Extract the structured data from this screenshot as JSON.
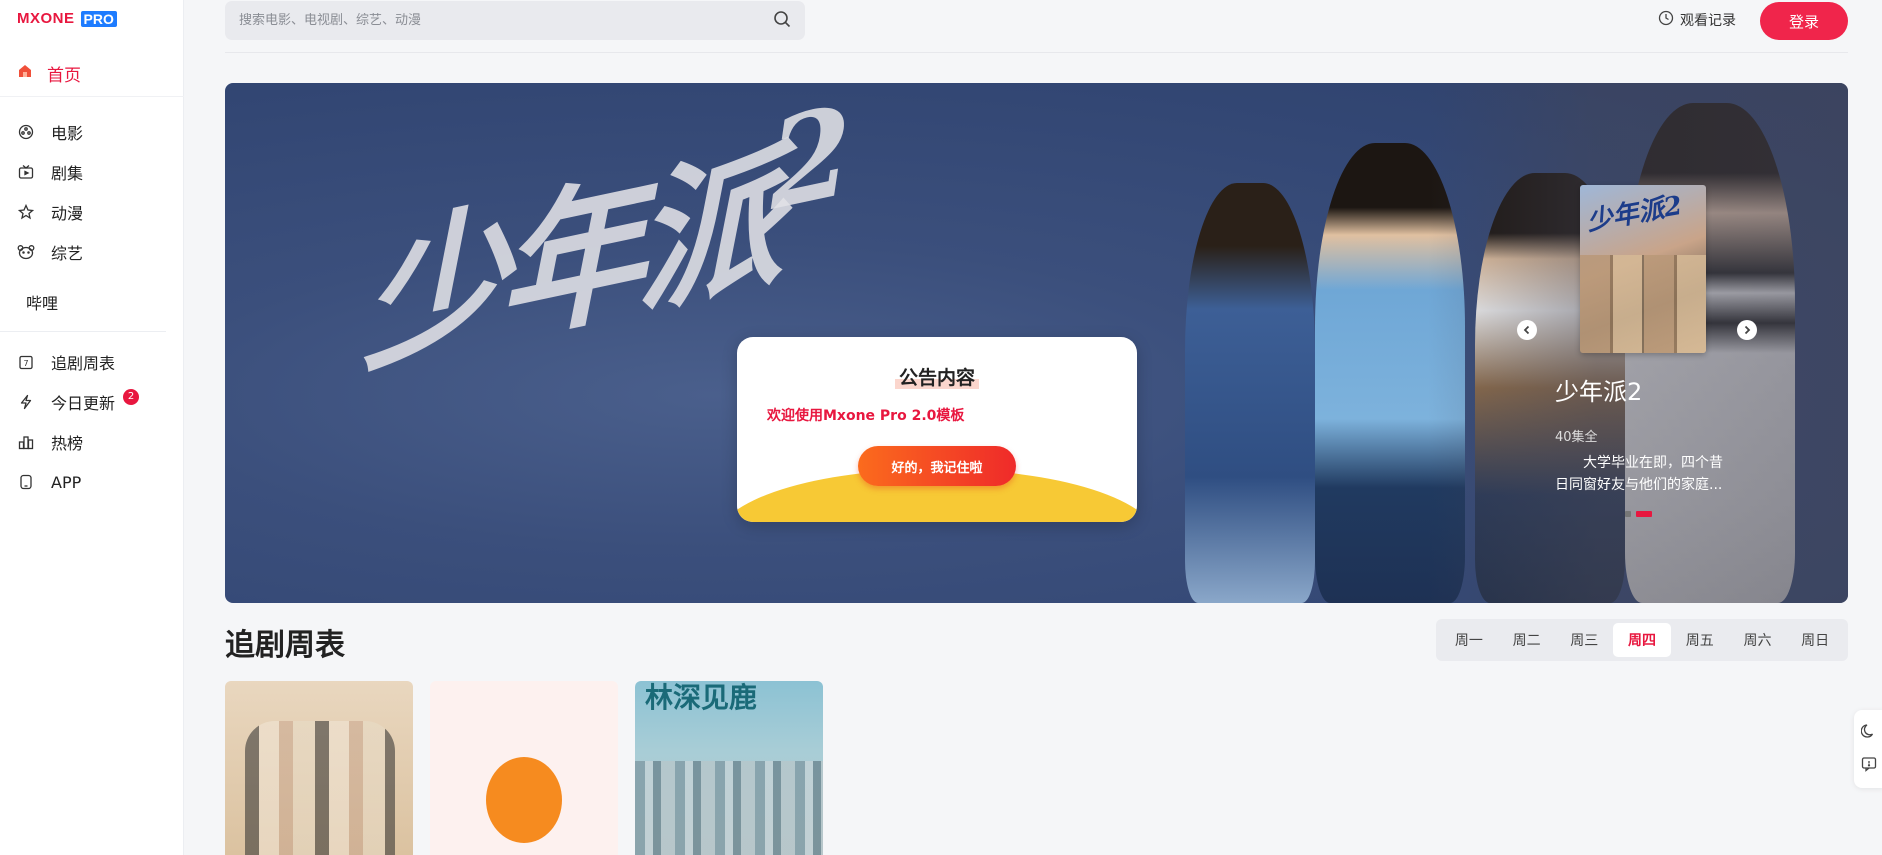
{
  "brand": {
    "logo_text": "MXONE",
    "logo_pro": "PRO"
  },
  "search": {
    "placeholder": "搜索电影、电视剧、综艺、动漫"
  },
  "header": {
    "history_label": "观看记录",
    "login_label": "登录"
  },
  "sidebar": {
    "home": "首页",
    "items": [
      {
        "label": "电影",
        "icon": "film-reel-icon"
      },
      {
        "label": "剧集",
        "icon": "tv-icon"
      },
      {
        "label": "动漫",
        "icon": "anime-star-icon"
      },
      {
        "label": "综艺",
        "icon": "bear-face-icon"
      },
      {
        "label": "哔哩"
      }
    ],
    "tools": [
      {
        "label": "追剧周表",
        "icon": "calendar-icon"
      },
      {
        "label": "今日更新",
        "icon": "lightning-icon",
        "badge": "2"
      },
      {
        "label": "热榜",
        "icon": "bar-chart-icon"
      },
      {
        "label": "APP",
        "icon": "phone-icon"
      }
    ]
  },
  "banner": {
    "title_art": "少年派",
    "title_num": "2",
    "slide": {
      "poster_title": "少年派2",
      "name": "少年派2",
      "episodes": "40集全",
      "description": "大学毕业在即，四个昔日同窗好友与他们的家庭..."
    },
    "dots": 2,
    "active_dot": 1
  },
  "modal": {
    "title": "公告内容",
    "message": "欢迎使用Mxone Pro 2.0模板",
    "button": "好的，我记住啦"
  },
  "schedule": {
    "title": "追剧周表",
    "days": [
      "周一",
      "周二",
      "周三",
      "周四",
      "周五",
      "周六",
      "周日"
    ],
    "active_day": "周四",
    "cards": [
      {
        "poster": "drama-family-poster"
      },
      {
        "poster": "orange-balloon-poster"
      },
      {
        "poster": "lin-jian-shen-lu-poster",
        "title_art": "林深见鹿"
      }
    ]
  },
  "colors": {
    "accent": "#e8173f",
    "brand_blue": "#1e7cff",
    "modal_yellow": "#f7c935"
  }
}
